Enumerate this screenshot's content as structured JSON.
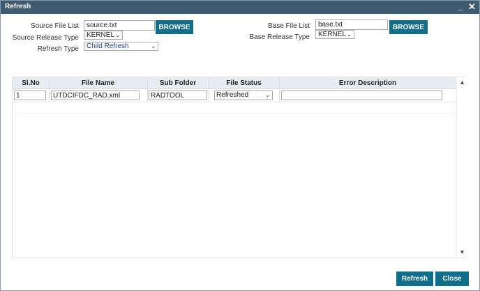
{
  "window": {
    "title": "Refresh",
    "minimize_label": "_",
    "close_label": "✕"
  },
  "form": {
    "source_file_list_label": "Source File List",
    "source_file_list_value": "source.txt",
    "source_browse_label": "BROWSE",
    "source_release_type_label": "Source Release Type",
    "source_release_type_value": "KERNEL",
    "refresh_type_label": "Refresh Type",
    "refresh_type_value": "Child Refresh",
    "base_file_list_label": "Base File List",
    "base_file_list_value": "base.txt",
    "base_browse_label": "BROWSE",
    "base_release_type_label": "Base Release Type",
    "base_release_type_value": "KERNEL"
  },
  "grid": {
    "columns": [
      "Sl.No",
      "File Name",
      "Sub Folder",
      "File Status",
      "Error Description"
    ],
    "rows": [
      {
        "slno": "1",
        "file_name": "UTDCIFDC_RAD.xml",
        "sub_folder": "RADTOOL",
        "file_status": "Refreshed",
        "error_description": ""
      }
    ]
  },
  "footer": {
    "refresh_label": "Refresh",
    "close_label": "Close"
  }
}
